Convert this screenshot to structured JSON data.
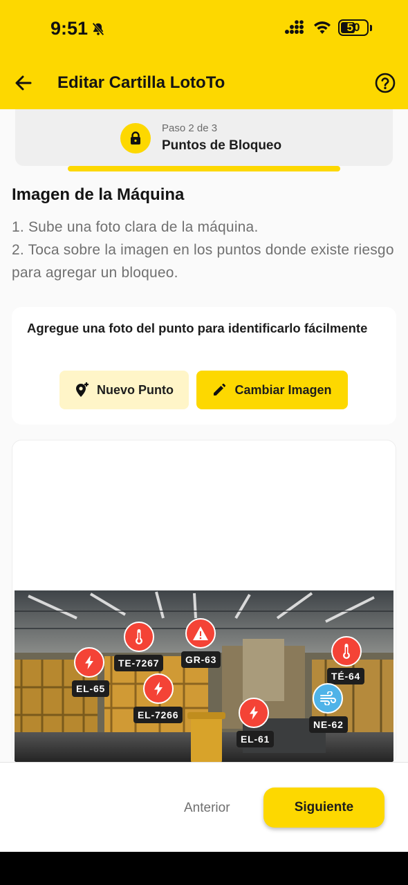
{
  "status_bar": {
    "time": "9:51",
    "battery": "50"
  },
  "app_bar": {
    "title": "Editar Cartilla LotoTo"
  },
  "step": {
    "subtitle": "Paso 2 de 3",
    "title": "Puntos de Bloqueo",
    "progress": 0.66
  },
  "section": {
    "title": "Imagen de la Máquina",
    "instruction_1": "1. Sube una foto clara de la máquina.",
    "instruction_2": "2. Toca sobre la imagen en los puntos donde existe riesgo para agregar un bloqueo."
  },
  "photo_card": {
    "text": "Agregue una foto del punto para identificarlo fácilmente",
    "new_point_label": "Nuevo Punto",
    "change_image_label": "Cambiar Imagen"
  },
  "pins": [
    {
      "label": "EL-65",
      "type": "electrical",
      "color": "#F44336"
    },
    {
      "label": "TE-7267",
      "type": "thermal",
      "color": "#F44336"
    },
    {
      "label": "GR-63",
      "type": "warning",
      "color": "#F44336"
    },
    {
      "label": "EL-7266",
      "type": "electrical",
      "color": "#F44336"
    },
    {
      "label": "EL-61",
      "type": "electrical",
      "color": "#F44336"
    },
    {
      "label": "TÉ-64",
      "type": "thermal",
      "color": "#F44336"
    },
    {
      "label": "NE-62",
      "type": "pneumatic",
      "color": "#4FB3E8"
    }
  ],
  "footer": {
    "previous_label": "Anterior",
    "next_label": "Siguiente"
  },
  "colors": {
    "primary": "#FDD800",
    "danger": "#F44336",
    "pneumatic": "#4FB3E8"
  }
}
